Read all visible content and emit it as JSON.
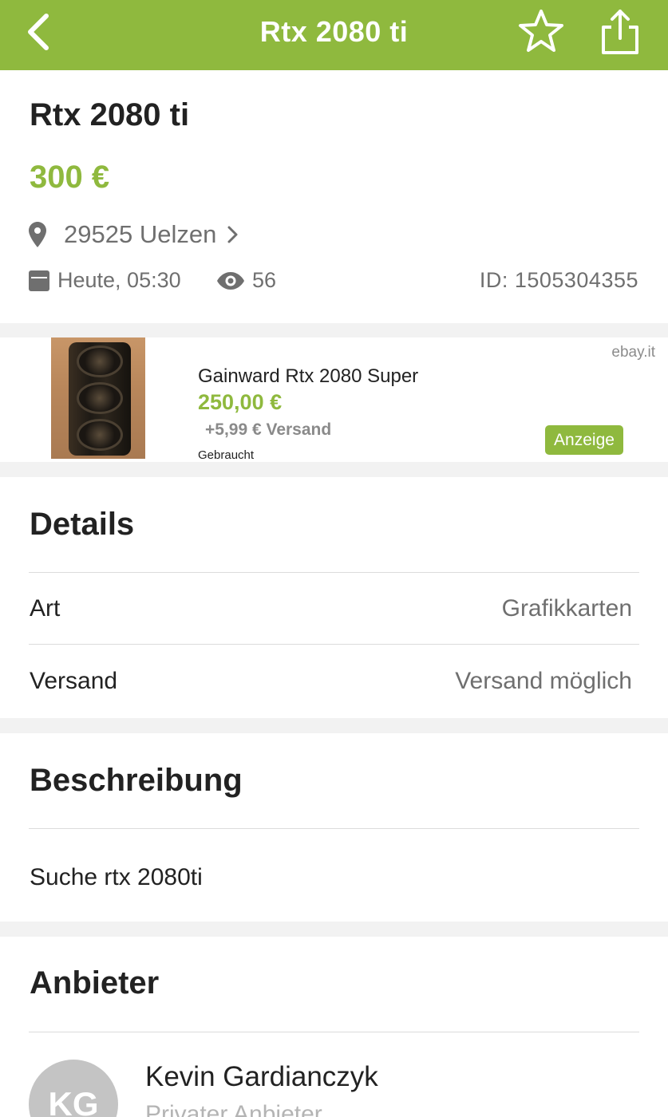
{
  "nav": {
    "title": "Rtx 2080 ti",
    "back_icon": "chevron-left-icon",
    "favorite_icon": "star-outline-icon",
    "share_icon": "share-icon"
  },
  "ad": {
    "title": "Rtx 2080 ti",
    "price": "300 €",
    "location": "29525 Uelzen",
    "date": "Heute, 05:30",
    "views": "56",
    "id": "ID: 1505304355"
  },
  "sponsored": {
    "source": "ebay.it",
    "title": "Gainward Rtx 2080 Super",
    "price": "250,00 €",
    "shipping": "+5,99 € Versand",
    "condition": "Gebraucht",
    "badge": "Anzeige"
  },
  "details": {
    "heading": "Details",
    "rows": [
      {
        "label": "Art",
        "value": "Grafikkarten"
      },
      {
        "label": "Versand",
        "value": "Versand möglich"
      }
    ]
  },
  "description": {
    "heading": "Beschreibung",
    "text": "Suche rtx 2080ti"
  },
  "seller": {
    "heading": "Anbieter",
    "initials": "KG",
    "name": "Kevin Gardianczyk",
    "type": "Privater Anbieter"
  },
  "colors": {
    "brand_green": "#8fb93e",
    "separator": "#f2f2f2",
    "text_gray": "#6f6f6f"
  }
}
